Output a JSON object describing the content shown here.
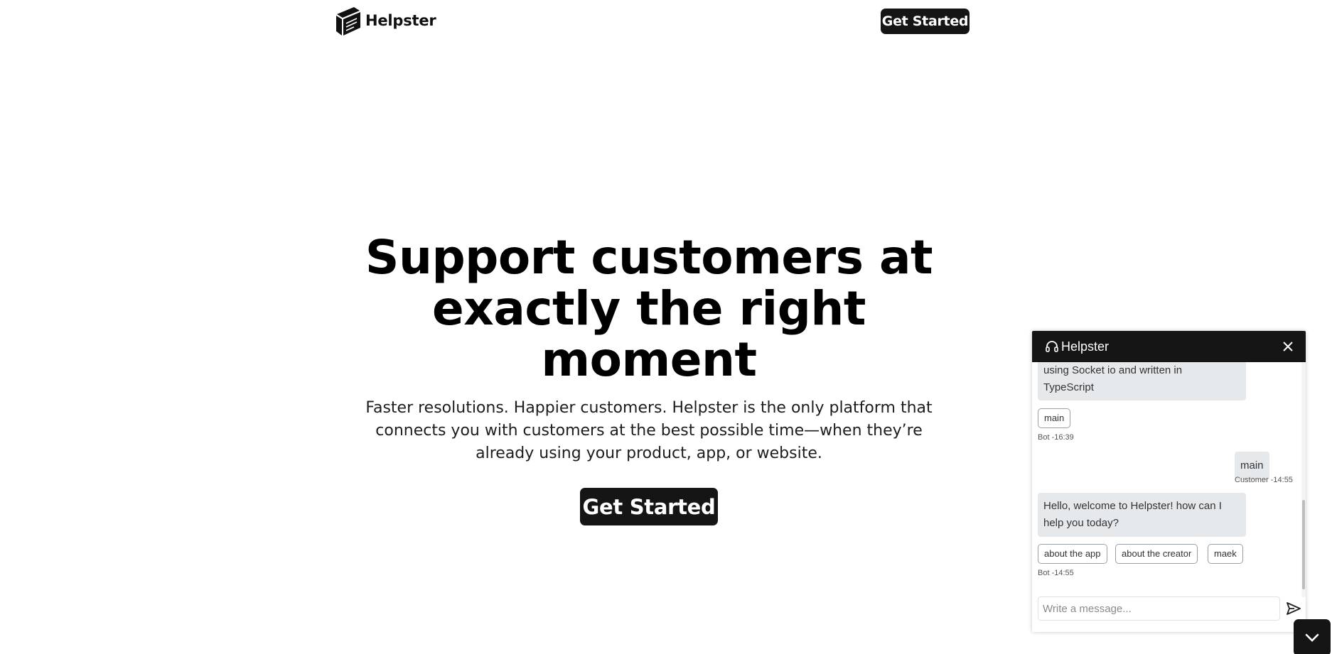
{
  "header": {
    "brand": "Helpster",
    "logo_icon": "book-stack-icon",
    "cta_label": "Get Started"
  },
  "hero": {
    "title_lines": [
      "Support customers at",
      "exactly the right",
      "moment"
    ],
    "subtitle": "Faster resolutions. Happier customers. Helpster is the only platform that connects you with customers at the best possible time—when they’re already using your product, app, or website.",
    "cta_label": "Get Started"
  },
  "chat": {
    "title": "Helpster",
    "header_icon": "headset-icon",
    "close_icon": "close-icon",
    "messages": {
      "bot1_text_line1": "using Socket io and written in",
      "bot1_text_line2": "TypeScript",
      "bot1_option": "main",
      "bot1_meta": "Bot -16:39",
      "cust1_text": "main",
      "cust1_meta": "Customer -14:55",
      "bot2_text_line1": "Hello, welcome to Helpster! how can I",
      "bot2_text_line2": "help you today?",
      "bot2_options": [
        "about the app",
        "about the creator",
        "maek"
      ],
      "bot2_meta": "Bot -14:55"
    },
    "input_placeholder": "Write a message...",
    "send_icon": "send-icon",
    "toggle_icon": "chevron-down-icon"
  },
  "colors": {
    "dark": "#151515",
    "bubble": "#e6e9ec",
    "background": "#ffffff"
  }
}
